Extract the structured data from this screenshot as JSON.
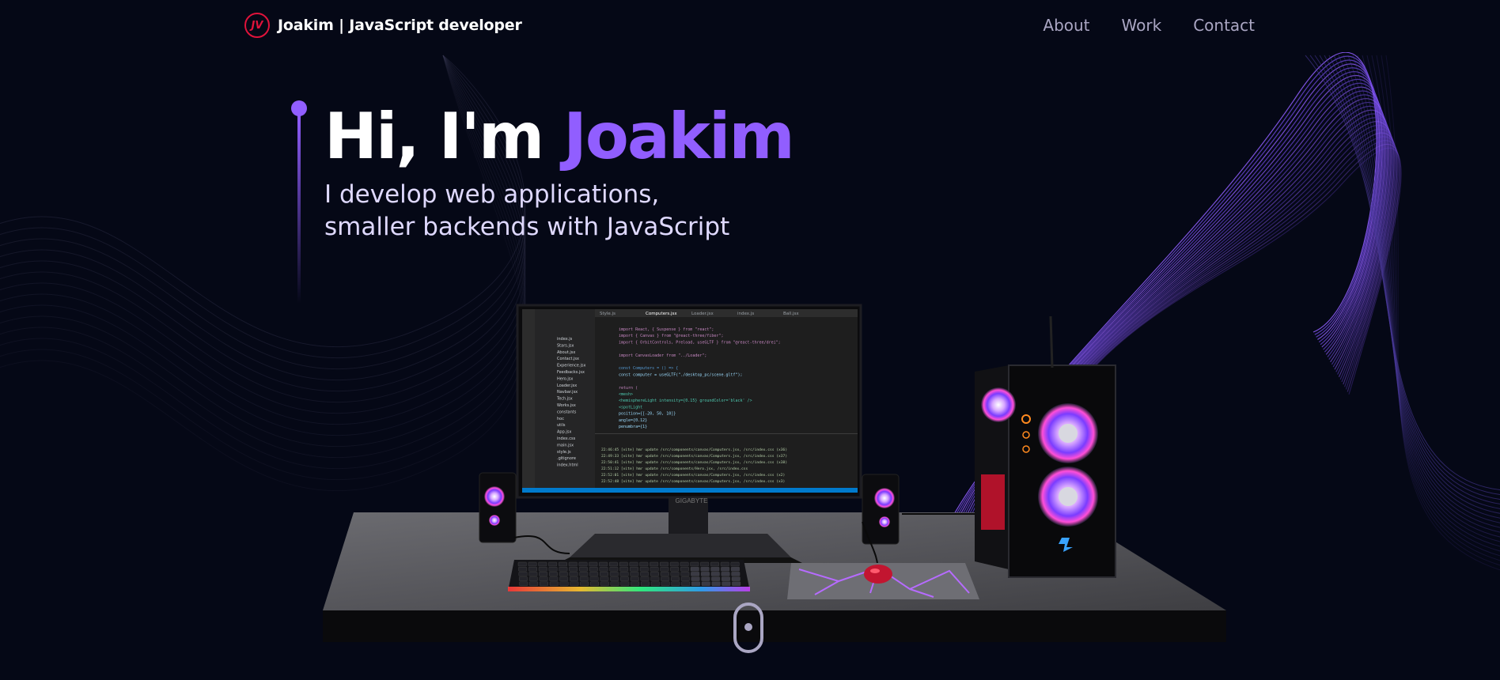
{
  "header": {
    "logo_text": "JV",
    "brand_text": "Joakim  | JavaScript developer",
    "nav": [
      {
        "label": "About"
      },
      {
        "label": "Work"
      },
      {
        "label": "Contact"
      }
    ]
  },
  "hero": {
    "greeting": "Hi, I'm ",
    "name": "Joakim",
    "subtitle_line1": "I develop web applications,",
    "subtitle_line2": "smaller backends with JavaScript"
  },
  "monitor": {
    "brand": "GIGABYTE",
    "tabs": [
      "Style.js",
      "Computers.jsx",
      "Loader.jsx",
      "index.js",
      "Ball.jsx"
    ],
    "files": [
      "index.js",
      "Stars.jsx",
      "About.jsx",
      "Contact.jsx",
      "Experience.jsx",
      "Feedbacks.jsx",
      "Hero.jsx",
      "Loader.jsx",
      "Navbar.jsx",
      "Tech.jsx",
      "Works.jsx",
      "constants",
      "hoc",
      "utils",
      "App.jsx",
      "index.css",
      "main.jsx",
      "style.js",
      ".gitignore",
      "index.html"
    ],
    "code_lines": [
      "import React, { Suspense } from \"react\";",
      "import { Canvas } from \"@react-three/fiber\";",
      "import { OrbitControls, Preload, useGLTF } from \"@react-three/drei\";",
      "",
      "import CanvasLoader from \"../Loader\";",
      "",
      "const Computers = () => {",
      "  const computer = useGLTF(\"./desktop_pc/scene.gltf\");",
      "",
      "  return (",
      "    <mesh>",
      "      <hemisphereLight intensity={0.15} groundColor='black' />",
      "      <spotLight",
      "        position={[-20, 50, 10]}",
      "        angle={0.12}",
      "        penumbra={1}"
    ],
    "terminal_lines": [
      "22:46:45 [vite] hmr update /src/components/canvas/Computers.jsx, /src/index.css (x36)",
      "22:49:33 [vite] hmr update /src/components/canvas/Computers.jsx, /src/index.css (x37)",
      "22:50:41 [vite] hmr update /src/components/canvas/Computers.jsx, /src/index.css (x38)",
      "22:51:12 [vite] hmr update /src/components/Hero.jsx, /src/index.css",
      "22:52:01 [vite] hmr update /src/components/canvas/Computers.jsx, /src/index.css (x2)",
      "22:52:48 [vite] hmr update /src/components/canvas/Computers.jsx, /src/index.css (x3)"
    ]
  },
  "colors": {
    "background": "#050816",
    "accent": "#915eff",
    "logo": "#e0133b",
    "nav_text": "#aaa6c3",
    "subtitle": "#dfd9ff"
  }
}
